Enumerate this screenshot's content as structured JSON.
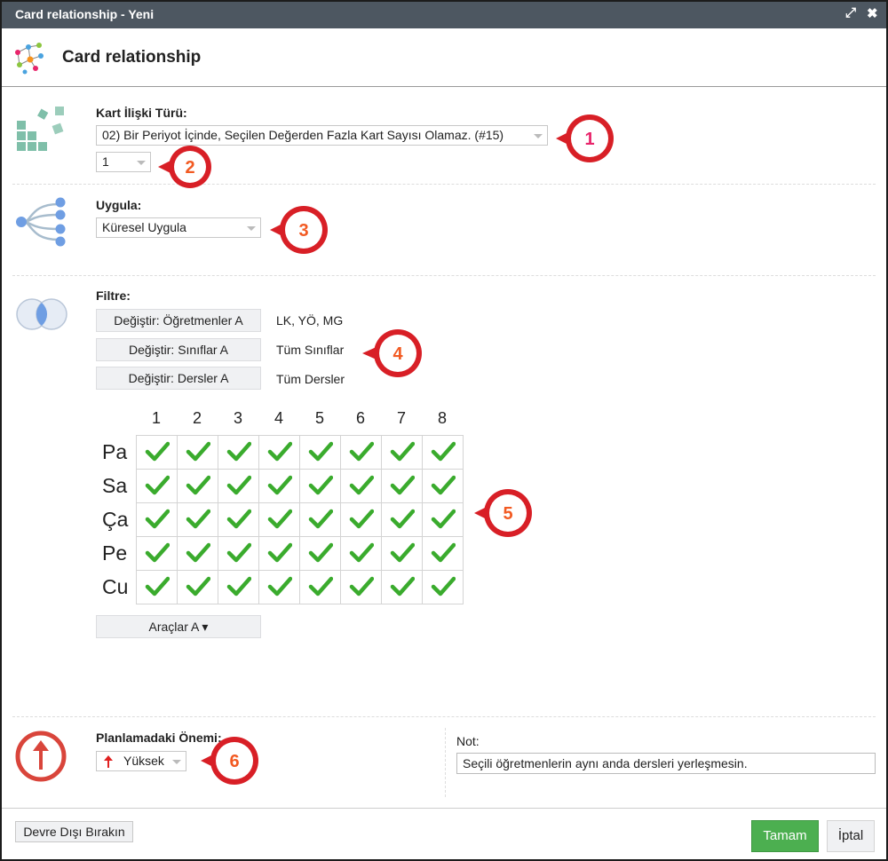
{
  "window": {
    "title": "Card relationship - Yeni",
    "header_title": "Card relationship"
  },
  "relation_type": {
    "label": "Kart İlişki Türü:",
    "selected": "02) Bir Periyot İçinde, Seçilen Değerden Fazla Kart Sayısı Olamaz. (#15)",
    "count_value": "1"
  },
  "apply": {
    "label": "Uygula:",
    "selected": "Küresel Uygula"
  },
  "filter": {
    "label": "Filtre:",
    "rows": [
      {
        "button": "Değiştir: Öğretmenler A",
        "value": "LK, YÖ, MG"
      },
      {
        "button": "Değiştir: Sınıflar A",
        "value": "Tüm Sınıflar"
      },
      {
        "button": "Değiştir: Dersler A",
        "value": "Tüm Dersler"
      }
    ]
  },
  "grid": {
    "columns": [
      "1",
      "2",
      "3",
      "4",
      "5",
      "6",
      "7",
      "8"
    ],
    "rows": [
      "Pa",
      "Sa",
      "Ça",
      "Pe",
      "Cu"
    ],
    "all_checked": true
  },
  "tools_button": "Araçlar A ▾",
  "importance": {
    "label": "Planlamadaki Önemi:",
    "selected": "Yüksek"
  },
  "note": {
    "label": "Not:",
    "value": "Seçili öğretmenlerin aynı anda dersleri yerleşmesin."
  },
  "footer": {
    "disable_label": "Devre Dışı Bırakın",
    "ok_label": "Tamam",
    "cancel_label": "İptal"
  },
  "markers": [
    {
      "num": "1",
      "color": "#e8256b"
    },
    {
      "num": "2",
      "color": "#f25a22"
    },
    {
      "num": "3",
      "color": "#f25a22"
    },
    {
      "num": "4",
      "color": "#f25a22"
    },
    {
      "num": "5",
      "color": "#f25a22"
    },
    {
      "num": "6",
      "color": "#f25a22"
    }
  ],
  "colors": {
    "titlebar": "#4d5761",
    "check": "#3aab2d",
    "ok_button": "#4caf50",
    "marker_ring": "#d81f26"
  },
  "icons": [
    "expand-icon",
    "close-icon",
    "network-icon",
    "blocks-icon",
    "tree-icon",
    "venn-icon",
    "priority-up-icon",
    "red-arrow-icon"
  ]
}
